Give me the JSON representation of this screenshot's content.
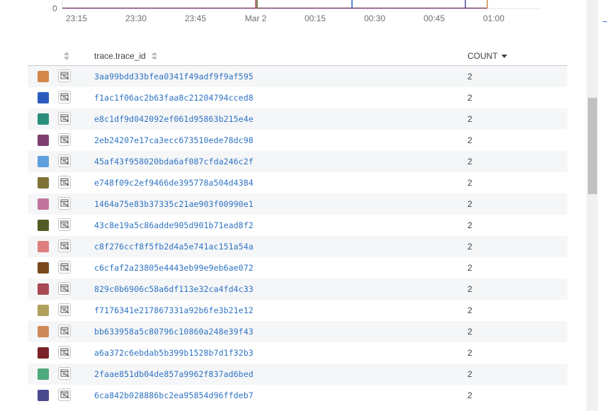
{
  "chart": {
    "y_zero_label": "0",
    "x_ticks": [
      "23:15",
      "23:30",
      "23:45",
      "Mar 2",
      "00:15",
      "00:30",
      "00:45",
      "01:00"
    ]
  },
  "table": {
    "header": {
      "id_column": "trace.trace_id",
      "count_column": "COUNT"
    },
    "rows": [
      {
        "color": "#d3874a",
        "trace_id": "3aa99bdd33bfea0341f49adf9f9af595",
        "count": "2"
      },
      {
        "color": "#2b5cc0",
        "trace_id": "f1ac1f06ac2b63faa8c21204794cced8",
        "count": "2"
      },
      {
        "color": "#2b8f7d",
        "trace_id": "e8c1df9d042092ef061d95863b215e4e",
        "count": "2"
      },
      {
        "color": "#7e3f6f",
        "trace_id": "2eb24207e17ca3ecc673510ede78dc98",
        "count": "2"
      },
      {
        "color": "#5ea0dc",
        "trace_id": "45af43f958020bda6af087cfda246c2f",
        "count": "2"
      },
      {
        "color": "#7f7436",
        "trace_id": "e748f09c2ef9466de395778a504d4384",
        "count": "2"
      },
      {
        "color": "#c3749e",
        "trace_id": "1464a75e83b37335c21ae903f00990e1",
        "count": "2"
      },
      {
        "color": "#545a23",
        "trace_id": "43c8e19a5c86adde905d901b71ead8f2",
        "count": "2"
      },
      {
        "color": "#de7e7e",
        "trace_id": "c8f276ccf8f5fb2d4a5e741ac151a54a",
        "count": "2"
      },
      {
        "color": "#784a1e",
        "trace_id": "c6cfaf2a23805e4443eb99e9eb6ae072",
        "count": "2"
      },
      {
        "color": "#a94753",
        "trace_id": "829c0b6906c58a6df113e32ca4fd4c33",
        "count": "2"
      },
      {
        "color": "#aea15c",
        "trace_id": "f7176341e217867331a92b6fe3b21e12",
        "count": "2"
      },
      {
        "color": "#cd8a5a",
        "trace_id": "bb633958a5c80796c10860a248e39f43",
        "count": "2"
      },
      {
        "color": "#7a2227",
        "trace_id": "a6a372c6ebdab5b399b1528b7d1f32b3",
        "count": "2"
      },
      {
        "color": "#4ea97c",
        "trace_id": "2faae851db04de857a9962f837ad6bed",
        "count": "2"
      },
      {
        "color": "#4a4b8e",
        "trace_id": "6ca842b028886bc2ea95854d96ffdeb7",
        "count": "2"
      }
    ]
  },
  "icons": {
    "header_sort": "sort-updown-icon",
    "row_action": "view-trace-icon"
  }
}
